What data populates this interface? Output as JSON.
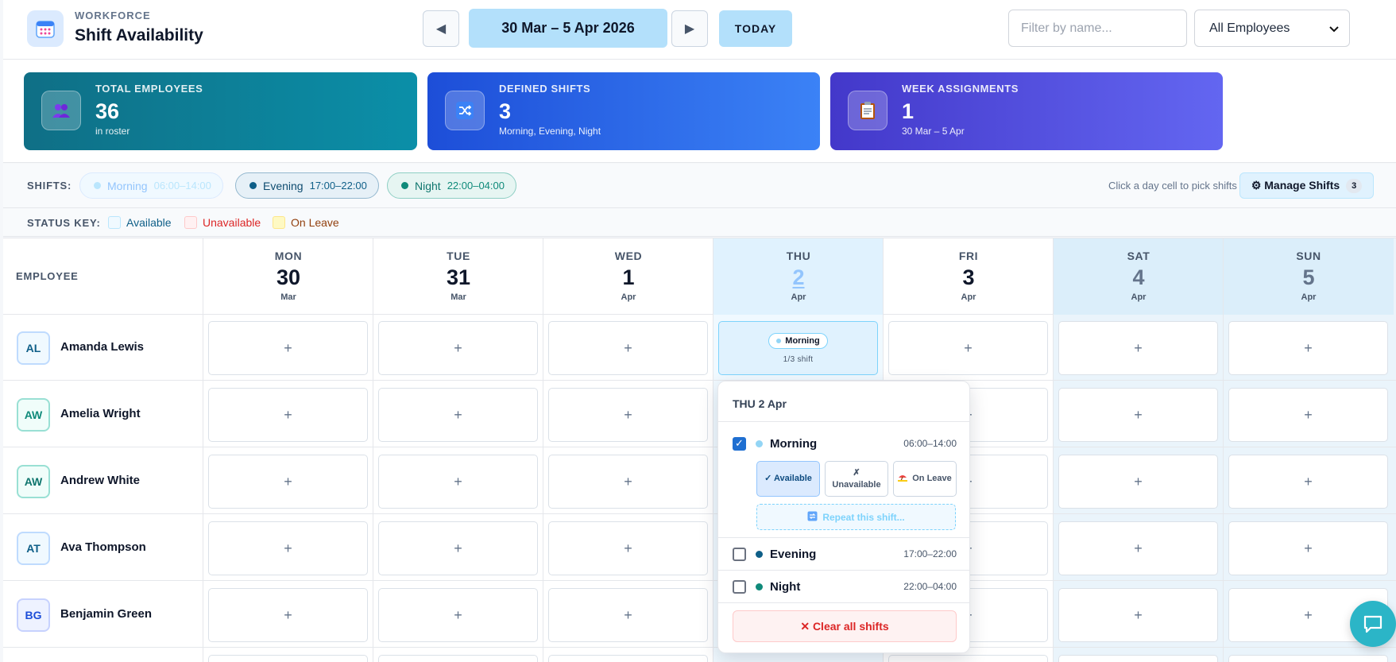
{
  "header": {
    "eyebrow": "WORKFORCE",
    "title": "Shift Availability",
    "week_range": "30 Mar – 5 Apr 2026",
    "today_label": "TODAY",
    "filter_placeholder": "Filter by name...",
    "employee_filter_value": "All Employees"
  },
  "stats": [
    {
      "label": "TOTAL EMPLOYEES",
      "value": "36",
      "sub": "in roster",
      "icon": "people-icon"
    },
    {
      "label": "DEFINED SHIFTS",
      "value": "3",
      "sub": "Morning, Evening, Night",
      "icon": "shuffle-icon"
    },
    {
      "label": "WEEK ASSIGNMENTS",
      "value": "1",
      "sub": "30 Mar – 5 Apr",
      "icon": "clipboard-icon"
    }
  ],
  "shifts_bar": {
    "label": "SHIFTS:",
    "shifts": [
      {
        "name": "Morning",
        "time": "06:00–14:00",
        "color": "#93d5f5"
      },
      {
        "name": "Evening",
        "time": "17:00–22:00",
        "color": "#0f5f88"
      },
      {
        "name": "Night",
        "time": "22:00–04:00",
        "color": "#0f8a7a"
      }
    ],
    "hint": "Click a day cell to pick shifts",
    "manage_label": "⚙ Manage Shifts",
    "manage_count": "3"
  },
  "status_key": {
    "label": "STATUS KEY:",
    "items": [
      {
        "label": "Available",
        "color": "#0f5f88"
      },
      {
        "label": "Unavailable",
        "color": "#dc2626"
      },
      {
        "label": "On Leave",
        "color": "#92400e"
      }
    ]
  },
  "grid": {
    "employee_header": "EMPLOYEE",
    "days": [
      {
        "dow": "MON",
        "num": "30",
        "mon": "Mar"
      },
      {
        "dow": "TUE",
        "num": "31",
        "mon": "Mar"
      },
      {
        "dow": "WED",
        "num": "1",
        "mon": "Apr"
      },
      {
        "dow": "THU",
        "num": "2",
        "mon": "Apr"
      },
      {
        "dow": "FRI",
        "num": "3",
        "mon": "Apr"
      },
      {
        "dow": "SAT",
        "num": "4",
        "mon": "Apr"
      },
      {
        "dow": "SUN",
        "num": "5",
        "mon": "Apr"
      }
    ],
    "add_symbol": "+",
    "employees": [
      {
        "initials": "AL",
        "name": "Amanda Lewis"
      },
      {
        "initials": "AW",
        "name": "Amelia Wright"
      },
      {
        "initials": "AW",
        "name": "Andrew White"
      },
      {
        "initials": "AT",
        "name": "Ava Thompson"
      },
      {
        "initials": "BG",
        "name": "Benjamin Green"
      }
    ],
    "assigned_cell": {
      "shift": "Morning",
      "sub": "1/3 shift"
    }
  },
  "popover": {
    "title": "THU 2 Apr",
    "shifts": [
      {
        "name": "Morning",
        "time": "06:00–14:00",
        "checked": true
      },
      {
        "name": "Evening",
        "time": "17:00–22:00",
        "checked": false
      },
      {
        "name": "Night",
        "time": "22:00–04:00",
        "checked": false
      }
    ],
    "status_available": "✓ Available",
    "status_unavailable_mark": "✗",
    "status_unavailable": "Unavailable",
    "status_on_leave": "On Leave",
    "repeat_label": "Repeat this shift...",
    "clear_label": "✕ Clear all shifts"
  }
}
